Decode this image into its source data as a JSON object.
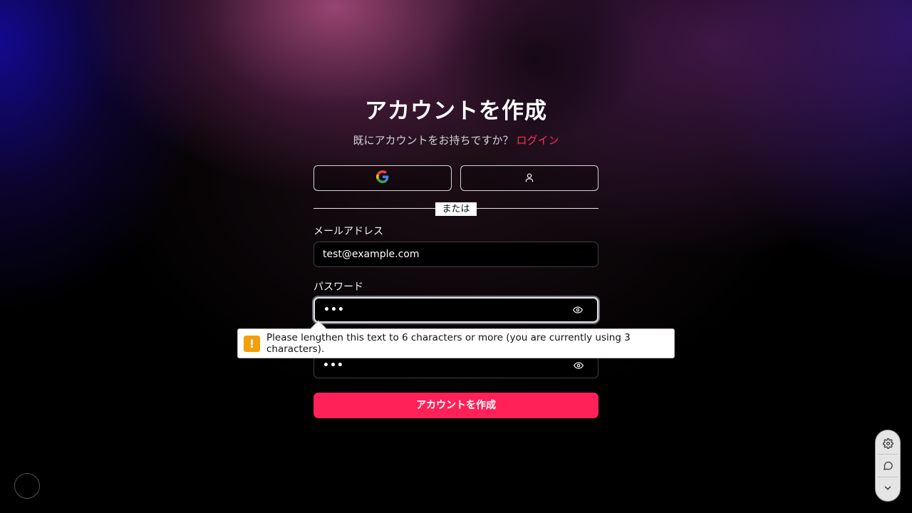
{
  "page": {
    "title": "アカウントを作成",
    "subtitle": "既にアカウントをお持ちですか？",
    "login_link": "ログイン"
  },
  "social": {
    "google_icon": "google-icon",
    "anon_icon": "user-icon"
  },
  "divider_label": "または",
  "email": {
    "label": "メールアドレス",
    "value": "test@example.com"
  },
  "password": {
    "label": "パスワード",
    "value_masked": "•••"
  },
  "confirm_password": {
    "value_masked": "•••"
  },
  "submit_label": "アカウントを作成",
  "validation_tooltip": {
    "icon": "!",
    "message": "Please lengthen this text to 6 characters or more (you are currently using 3 characters)."
  },
  "toolbar": {
    "items": [
      "gear-icon",
      "chat-icon",
      "chevron-down-icon"
    ]
  },
  "colors": {
    "accent": "#ff2158",
    "link": "#ff2d5a",
    "warning": "#f59e0b"
  }
}
